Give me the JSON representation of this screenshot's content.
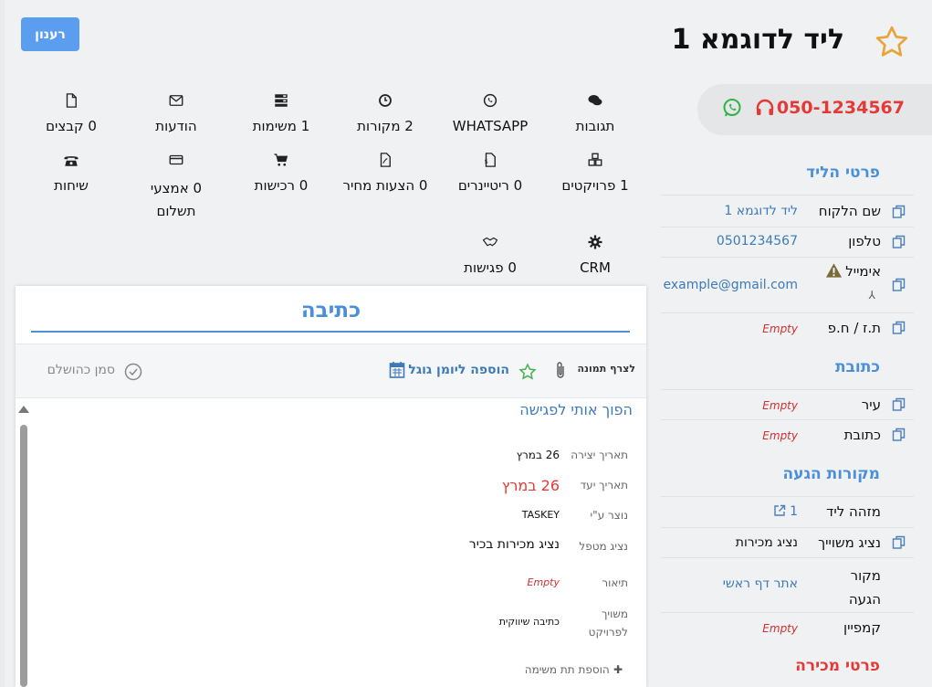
{
  "header": {
    "refresh_label": "רענון",
    "title": "ליד לדוגמא 1",
    "phone": "050-1234567"
  },
  "toolbar": {
    "row1": [
      {
        "label": "תגובות",
        "icon": "comments-icon"
      },
      {
        "label": "WHATSAPP",
        "icon": "whatsapp-icon"
      },
      {
        "label": "2 מקורות",
        "icon": "clock-icon"
      },
      {
        "label": "1 משימות",
        "icon": "tasks-icon"
      },
      {
        "label": "הודעות",
        "icon": "envelope-icon"
      },
      {
        "label": "0 קבצים",
        "icon": "file-icon"
      }
    ],
    "row2": [
      {
        "label": "1 פרויקטים",
        "icon": "cubes-icon"
      },
      {
        "label": "0 ריטיינרים",
        "icon": "invoice-icon"
      },
      {
        "label": "0 הצעות מחיר",
        "icon": "pdf-icon"
      },
      {
        "label": "0 רכישות",
        "icon": "cart-icon"
      },
      {
        "label": "0 אמצעי תשלום",
        "icon": "credit-card-icon"
      },
      {
        "label": "שיחות",
        "icon": "telephone-icon"
      }
    ],
    "row3": [
      {
        "label": "CRM",
        "icon": "gear-icon"
      },
      {
        "label": "0 פגישות",
        "icon": "handshake-icon"
      }
    ]
  },
  "lead_details": {
    "heading": "פרטי הליד",
    "customer_name_label": "שם הלקוח",
    "customer_name": "ליד לדוגמא 1",
    "phone_label": "טלפון",
    "phone": "0501234567",
    "email_label": "אימייל",
    "email": "example@gmail.com",
    "id_label": "ת.ז / ח.פ",
    "id_value": "Empty"
  },
  "address": {
    "heading": "כתובת",
    "city_label": "עיר",
    "city_value": "Empty",
    "address_label": "כתובת",
    "address_value": "Empty"
  },
  "sources": {
    "heading": "מקורות הגעה",
    "lead_id_label": "מזהה ליד",
    "lead_id": "1",
    "rep_label": "נציג משוייך",
    "rep": "נציג מכירות",
    "source_label": "מקור הגעה",
    "source": "אתר דף ראשי",
    "campaign_label": "קמפיין",
    "campaign": "Empty"
  },
  "sales": {
    "heading": "פרטי מכירה"
  },
  "task_card": {
    "title": "כתיבה",
    "attach_label": "לצרף תמונה",
    "gcal_label": "הוספה ליומן גוגל",
    "mark_done_label": "סמן כהושלם",
    "task_name": "הפוך אותי לפגישה",
    "created_label": "תאריך יצירה",
    "created_value": "26 במרץ",
    "due_label": "תאריך יעד",
    "due_value": "26 במרץ",
    "creator_label": "נוצר ע\"י",
    "creator_value": "TASKEY",
    "handler_label": "נציג מטפל",
    "handler_value": "נציג מכירות בכיר",
    "desc_label": "תיאור",
    "desc_value": "Empty",
    "project_label": "משויך לפרויקט",
    "project_value": "כתיבה שיווקית",
    "add_subtask_label": "הוספת תת משימה"
  },
  "colors": {
    "accent": "#4a8fd8",
    "danger": "#e53935",
    "button": "#5b9ef0"
  }
}
